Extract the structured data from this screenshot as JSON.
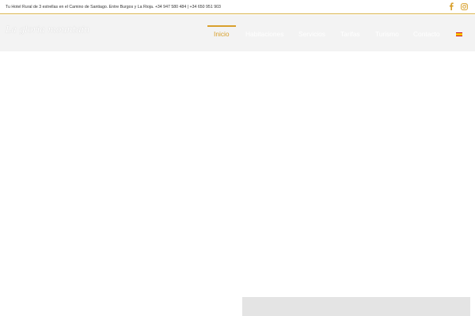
{
  "topbar": {
    "info_text": "Tu Hotel Rural de 3 estrellas en el Camino de Santiago. Entre Burgos y La Rioja. +34 947 580 484 | +34 650 951 903",
    "social": [
      {
        "name": "facebook-icon",
        "glyph": "f"
      },
      {
        "name": "instagram-icon",
        "glyph": "◎"
      }
    ]
  },
  "header": {
    "logo_text": "La gloria mountain",
    "nav": [
      {
        "label": "Inicio",
        "active": true
      },
      {
        "label": "Habitaciones",
        "active": false
      },
      {
        "label": "Servicios",
        "active": false
      },
      {
        "label": "Tarifas",
        "active": false
      },
      {
        "label": "Turismo",
        "active": false
      },
      {
        "label": "Contacto",
        "active": false
      }
    ],
    "language_icon": "spain-flag-icon"
  },
  "colors": {
    "accent": "#d8a02c",
    "header_bg": "#f3f3f3",
    "social_icon": "#d8a02c"
  }
}
